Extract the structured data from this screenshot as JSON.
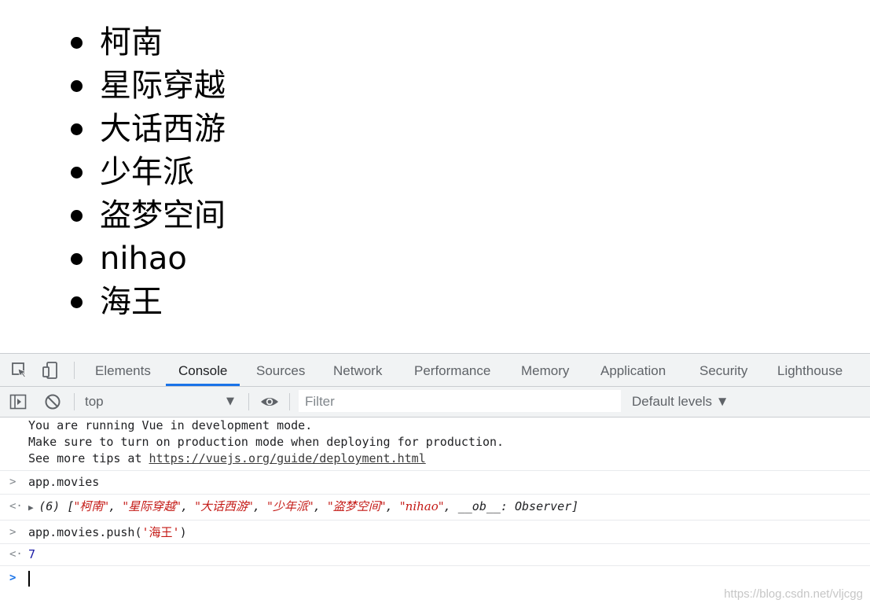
{
  "page": {
    "movies": [
      "柯南",
      "星际穿越",
      "大话西游",
      "少年派",
      "盗梦空间",
      "nihao",
      "海王"
    ]
  },
  "devtools": {
    "tabs": [
      "Elements",
      "Console",
      "Sources",
      "Network",
      "Performance",
      "Memory",
      "Application",
      "Security",
      "Lighthouse"
    ],
    "active_tab": "Console",
    "toolbar": {
      "context": "top",
      "filter_placeholder": "Filter",
      "levels_label": "Default levels ▼"
    },
    "console": {
      "vue_notice": {
        "line1": "You are running Vue in development mode.",
        "line2": "Make sure to turn on production mode when deploying for production.",
        "line3_prefix": "See more tips at ",
        "line3_link": "https://vuejs.org/guide/deployment.html"
      },
      "input1": "app.movies",
      "output1": {
        "count": "(6) [",
        "items": [
          "\"柯南\"",
          "\"星际穿越\"",
          "\"大话西游\"",
          "\"少年派\"",
          "\"盗梦空间\"",
          "\"nihao\""
        ],
        "tail": "__ob__: Observer]"
      },
      "input2_prefix": "app.movies.push(",
      "input2_arg": "'海王'",
      "input2_suffix": ")",
      "output2": "7"
    }
  },
  "watermark": "https://blog.csdn.net/vljcgg",
  "colors": {
    "accent": "#1a73e8",
    "string": "#c41a16",
    "number": "#1a1aa6",
    "toolbar_bg": "#f1f3f4"
  }
}
